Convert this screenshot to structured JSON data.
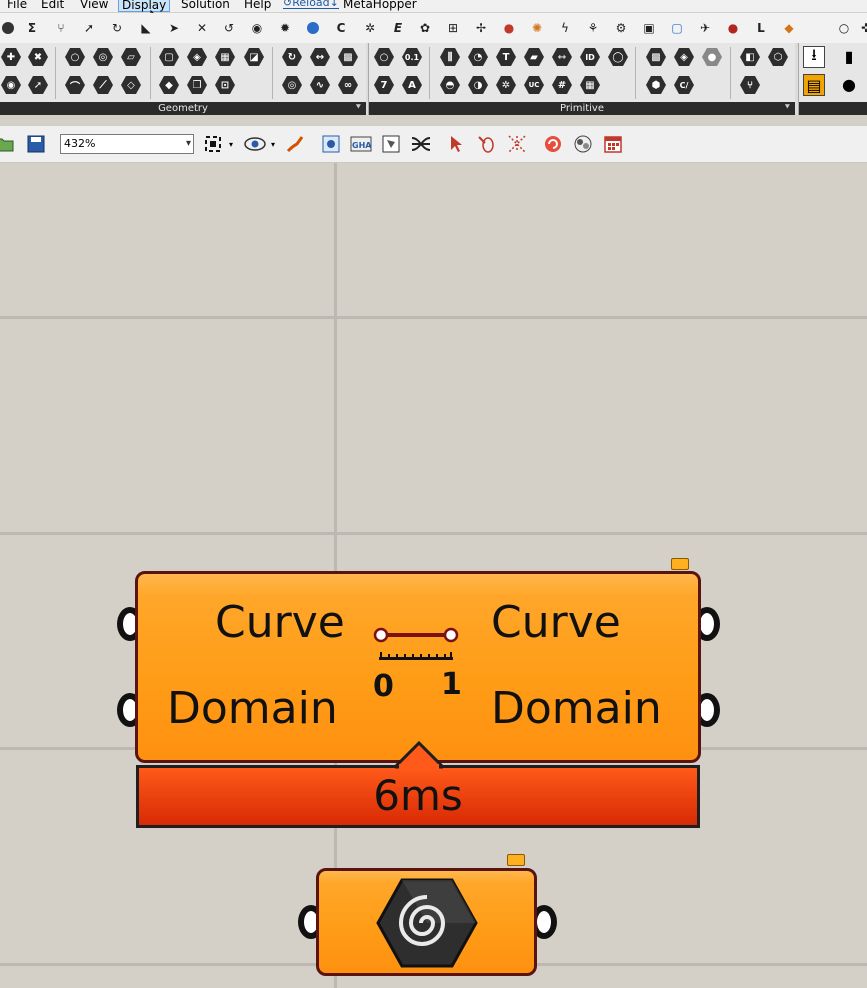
{
  "menu": {
    "items": [
      "File",
      "Edit",
      "View",
      "Display",
      "Solution",
      "Help"
    ],
    "reload": "Reload",
    "metahopper": "MetaHopper",
    "active": "Display"
  },
  "ribbon": {
    "panels": [
      {
        "name": "geometry-panel",
        "label": "Geometry"
      },
      {
        "name": "primitive-panel",
        "label": "Primitive"
      }
    ],
    "icon_labels": {
      "num": "0.1",
      "seven": "7",
      "text": "A",
      "id": "ID",
      "t": "T",
      "uc": "UC",
      "cs": "C/"
    }
  },
  "canvas_toolbar": {
    "zoom": "432%"
  },
  "components": {
    "main": {
      "inputs": [
        "Curve",
        "Domain"
      ],
      "outputs": [
        "Curve",
        "Domain"
      ],
      "icon_labels": [
        "0",
        "1"
      ],
      "timer": "6ms"
    },
    "secondary": {
      "icon": "spiral-hex-icon"
    }
  },
  "colors": {
    "component_fill": "#ff9d17",
    "component_border": "#5a1410",
    "timer_fill": "#e23a08",
    "canvas_bg": "#d4d0c8"
  }
}
